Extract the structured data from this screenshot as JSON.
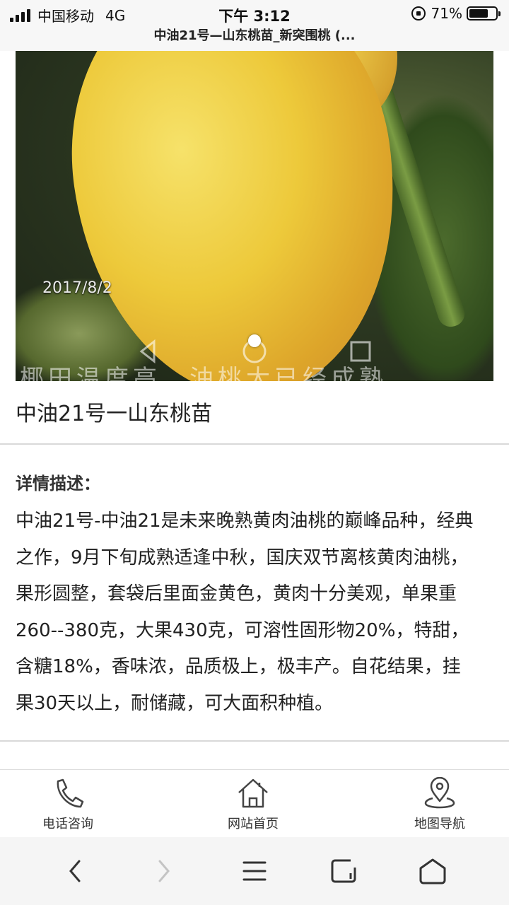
{
  "status_bar": {
    "carrier": "中国移动",
    "network": "4G",
    "time": "下午 3:12",
    "battery": "71%",
    "battery_level": 0.71
  },
  "page_title": "中油21号—山东桃苗_新突围桃 (...",
  "hero": {
    "date_stamp": "2017/8/2",
    "watermark_text": "椰田温度高，油桃大已经成熟",
    "active_slide": 1,
    "slide_count": 1
  },
  "product": {
    "title": "中油21号一山东桃苗"
  },
  "description": {
    "label": "详情描述：",
    "lines": [
      "中油21号-中油21是未来晚熟黄肉油桃的巅峰品种，经典",
      "之作，9月下旬成熟适逢中秋，国庆双节离核黄肉油桃，",
      "果形圆整，套袋后里面金黄色，黄肉十分美观，单果重",
      "260--380克，大果430克，可溶性固形物20%，特甜，",
      "含糖18%，香味浓，品质极上，极丰产。自花结果，挂",
      "果30天以上，耐储藏，可大面积种植。"
    ]
  },
  "bottom_nav": {
    "phone_label": "电话咨询",
    "home_label": "网站首页",
    "map_label": "地图导航"
  },
  "browser_toolbar": {
    "icons": [
      "back-icon",
      "forward-icon",
      "menu-icon",
      "tabs-icon",
      "home-icon"
    ]
  }
}
